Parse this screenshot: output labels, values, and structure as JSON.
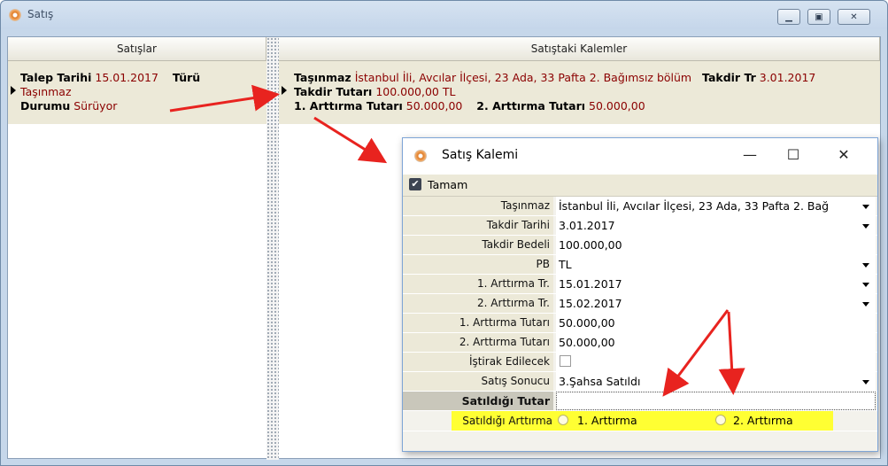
{
  "window": {
    "title": "Satış",
    "minimize_icon": "minimize-icon",
    "maximize_icon": "maximize-icon",
    "close_icon": "close-icon"
  },
  "left_grid": {
    "header": "Satışlar",
    "record": {
      "talep_label": "Talep Tarihi",
      "talep_value": "15.01.2017",
      "turu_label": "Türü",
      "turu_value": "Taşınmaz",
      "durum_label": "Durumu",
      "durum_value": "Sürüyor"
    }
  },
  "right_grid": {
    "header": "Satıştaki Kalemler",
    "record": {
      "tasinmaz_label": "Taşınmaz",
      "tasinmaz_value": "İstanbul İli, Avcılar İlçesi, 23 Ada, 33 Pafta 2. Bağımsız bölüm",
      "takdir_tr_label": "Takdir Tr",
      "takdir_tr_value": "3.01.2017",
      "takdir_tutari_label": "Takdir Tutarı",
      "takdir_tutari_value": "100.000,00 TL",
      "art1_label": "1. Arttırma Tutarı",
      "art1_value": "50.000,00",
      "art2_label": "2. Arttırma Tutarı",
      "art2_value": "50.000,00"
    }
  },
  "dialog": {
    "title": "Satış Kalemi",
    "minimize_glyph": "—",
    "maximize_glyph": "☐",
    "close_glyph": "✕",
    "toolbar": {
      "ok_label": "Tamam",
      "ok_check": "✔"
    },
    "fields": [
      {
        "label": "Taşınmaz",
        "value": "İstanbul İli, Avcılar İlçesi, 23 Ada, 33 Pafta 2. Bağ",
        "dropdown": true
      },
      {
        "label": "Takdir Tarihi",
        "value": "3.01.2017",
        "dropdown": true
      },
      {
        "label": "Takdir Bedeli",
        "value": "100.000,00",
        "dropdown": false
      },
      {
        "label": "PB",
        "value": "TL",
        "dropdown": true
      },
      {
        "label": "1. Arttırma Tr.",
        "value": "15.01.2017",
        "dropdown": true
      },
      {
        "label": "2. Arttırma Tr.",
        "value": "15.02.2017",
        "dropdown": true
      },
      {
        "label": "1. Arttırma Tutarı",
        "value": "50.000,00",
        "dropdown": false
      },
      {
        "label": "2. Arttırma Tutarı",
        "value": "50.000,00",
        "dropdown": false
      },
      {
        "label": "İştirak Edilecek",
        "value": "",
        "checkbox": true,
        "checked": false
      },
      {
        "label": "Satış Sonucu",
        "value": "3.Şahsa Satıldı",
        "dropdown": true
      },
      {
        "label": "Satıldığı Tutar",
        "value": "",
        "dropdown": false,
        "focused": true
      }
    ],
    "radio_field": {
      "label": "Satıldığı Arttırma",
      "options": [
        "1. Arttırma",
        "2. Arttırma"
      ],
      "selected": null,
      "highlight_color": "#ffff33"
    }
  },
  "colors": {
    "value_text": "#8b0000",
    "annotation_arrow": "#e8231f",
    "panel_bg": "#ece9d8"
  }
}
